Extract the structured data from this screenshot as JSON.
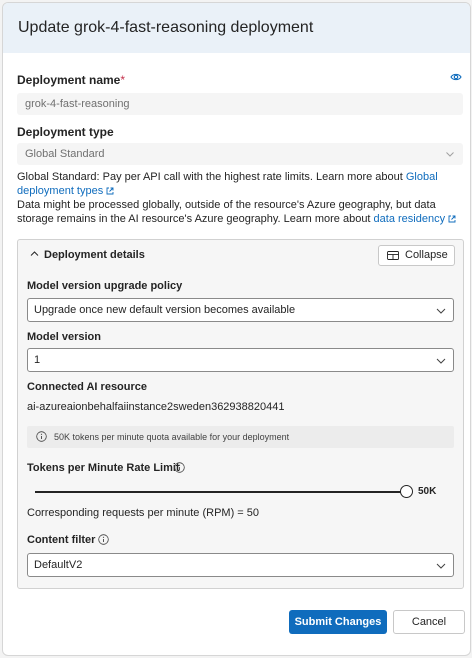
{
  "dialog": {
    "title": "Update grok-4-fast-reasoning deployment"
  },
  "deployment_name": {
    "label": "Deployment name",
    "required_mark": "*",
    "value": "grok-4-fast-reasoning"
  },
  "deployment_type": {
    "label": "Deployment type",
    "value": "Global Standard",
    "description_1_prefix": "Global Standard: Pay per API call with the highest rate limits. Learn more about ",
    "description_1_link": "Global deployment types",
    "description_2_prefix": "Data might be processed globally, outside of the resource's Azure geography, but data storage remains in the AI resource's Azure geography. Learn more about ",
    "description_2_link": "data residency"
  },
  "details": {
    "title": "Deployment details",
    "collapse_label": "Collapse",
    "upgrade_policy": {
      "label": "Model version upgrade policy",
      "value": "Upgrade once new default version becomes available"
    },
    "model_version": {
      "label": "Model version",
      "value": "1"
    },
    "connected_resource": {
      "label": "Connected AI resource",
      "value": "ai-azureaionbehalfaiinstance2sweden362938820441"
    },
    "quota_note": "50K tokens per minute quota available for your deployment",
    "rate_limit": {
      "label": "Tokens per Minute Rate Limit",
      "value_label": "50K",
      "level_fraction": 1.0
    },
    "rpm_text": "Corresponding requests per minute (RPM) = 50",
    "content_filter": {
      "label": "Content filter",
      "value": "DefaultV2"
    }
  },
  "footer": {
    "submit_label": "Submit Changes",
    "cancel_label": "Cancel"
  },
  "colors": {
    "accent": "#0f6cbd",
    "header_bg": "#eaf1f8",
    "required": "#c4314b"
  }
}
